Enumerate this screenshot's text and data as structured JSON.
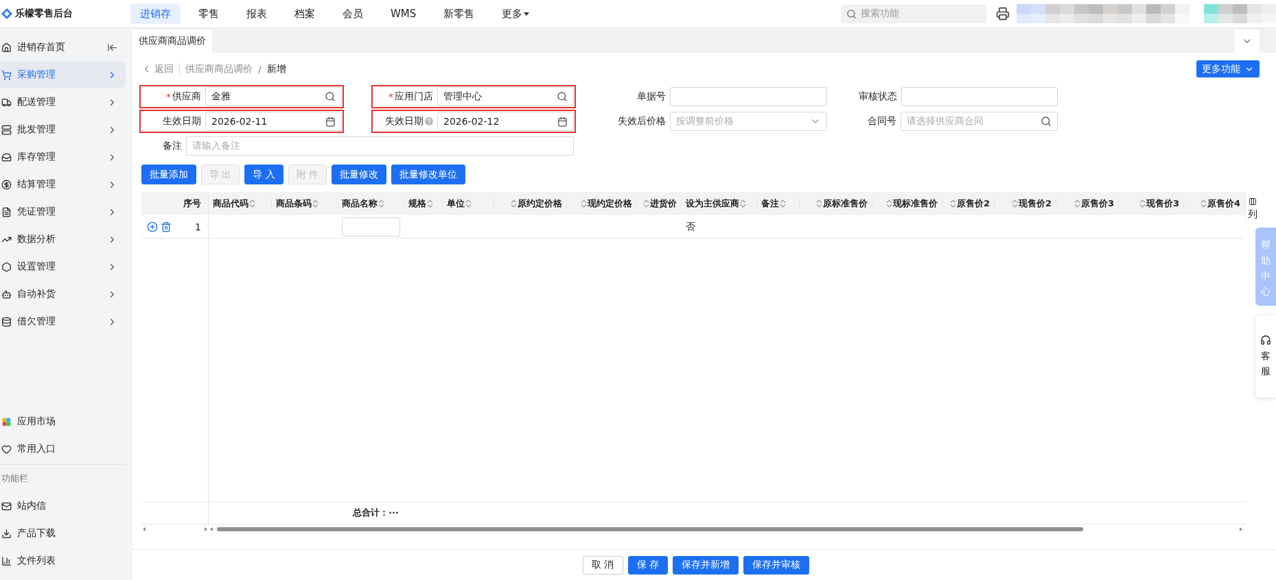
{
  "app": {
    "name": "乐檬零售后台"
  },
  "top_nav": [
    {
      "label": "进销存",
      "selected": true
    },
    {
      "label": "零售",
      "selected": false
    },
    {
      "label": "报表",
      "selected": false
    },
    {
      "label": "档案",
      "selected": false
    },
    {
      "label": "会员",
      "selected": false
    },
    {
      "label": "WMS",
      "selected": false
    },
    {
      "label": "新零售",
      "selected": false
    },
    {
      "label": "更多",
      "selected": false,
      "dropdown": true
    }
  ],
  "search": {
    "placeholder": "搜索功能"
  },
  "sidebar": {
    "items": [
      {
        "label": "进销存首页",
        "selected": false,
        "kind": "home"
      },
      {
        "label": "采购管理",
        "selected": true,
        "kind": "menu"
      },
      {
        "label": "配送管理",
        "selected": false,
        "kind": "menu"
      },
      {
        "label": "批发管理",
        "selected": false,
        "kind": "menu"
      },
      {
        "label": "库存管理",
        "selected": false,
        "kind": "menu"
      },
      {
        "label": "结算管理",
        "selected": false,
        "kind": "menu"
      },
      {
        "label": "凭证管理",
        "selected": false,
        "kind": "menu"
      },
      {
        "label": "数据分析",
        "selected": false,
        "kind": "menu"
      },
      {
        "label": "设置管理",
        "selected": false,
        "kind": "menu"
      },
      {
        "label": "自动补货",
        "selected": false,
        "kind": "menu"
      },
      {
        "label": "借欠管理",
        "selected": false,
        "kind": "menu"
      }
    ],
    "shortcuts": [
      {
        "label": "应用市场"
      },
      {
        "label": "常用入口"
      }
    ],
    "toolbar_heading": "功能栏",
    "tools": [
      {
        "label": "站内信"
      },
      {
        "label": "产品下载"
      },
      {
        "label": "文件列表"
      }
    ]
  },
  "tabs": [
    {
      "label": "供应商商品调价",
      "selected": true
    }
  ],
  "breadcrumb": {
    "back": "返回",
    "parent": "供应商商品调价",
    "separator": "/",
    "current": "新增"
  },
  "more_button": "更多功能",
  "form": {
    "rows": [
      [
        {
          "label": "供应商",
          "required_mark": "*",
          "kind": "search",
          "value": "金雅",
          "highlighted": true
        },
        {
          "label": "应用门店",
          "required_mark": "*",
          "kind": "search",
          "value": "管理中心",
          "highlighted": true
        },
        {
          "label": "单据号",
          "kind": "text",
          "highlighted": false
        },
        {
          "label": "审核状态",
          "kind": "text",
          "highlighted": false
        }
      ],
      [
        {
          "label": "生效日期",
          "kind": "date",
          "value": "2026-02-11",
          "highlighted": true
        },
        {
          "label": "失效日期",
          "kind": "date",
          "help": true,
          "value": "2026-02-12",
          "highlighted": true
        },
        {
          "label": "失效后价格",
          "kind": "select",
          "placeholder": "按调整前价格",
          "highlighted": false
        },
        {
          "label": "合同号",
          "kind": "search",
          "placeholder": "请选择供应商合同",
          "highlighted": false
        }
      ],
      [
        {
          "label": "备注",
          "kind": "wide",
          "placeholder": "请输入备注",
          "highlighted": false
        }
      ]
    ]
  },
  "actions": [
    {
      "label": "批量添加",
      "disabled": false
    },
    {
      "label": "导 出",
      "disabled": true
    },
    {
      "label": "导 入",
      "disabled": false
    },
    {
      "label": "附 件",
      "disabled": true
    },
    {
      "label": "批量修改",
      "disabled": false
    },
    {
      "label": "批量修改单位",
      "disabled": false
    }
  ],
  "table": {
    "index_header": "序号",
    "columns": [
      {
        "label": "商品代码",
        "kind": "trailing"
      },
      {
        "label": "商品条码",
        "kind": "trailing"
      },
      {
        "label": "商品名称",
        "kind": "trailing"
      },
      {
        "label": "规格",
        "kind": "trailing"
      },
      {
        "label": "单位",
        "kind": "trailing"
      },
      {
        "label": "原约定价格",
        "kind": "leading"
      },
      {
        "label": "现约定价格",
        "kind": "leading"
      },
      {
        "label": "进货价",
        "kind": "leading"
      },
      {
        "label": "设为主供应商",
        "kind": "trailing"
      },
      {
        "label": "备注",
        "kind": "trailing"
      },
      {
        "label": "原标准售价",
        "kind": "leading"
      },
      {
        "label": "现标准售价",
        "kind": "leading"
      },
      {
        "label": "原售价2",
        "kind": "leading"
      },
      {
        "label": "现售价2",
        "kind": "leading"
      },
      {
        "label": "原售价3",
        "kind": "leading"
      },
      {
        "label": "现售价3",
        "kind": "leading"
      },
      {
        "label": "原售价4",
        "kind": "leading"
      }
    ],
    "column_settings": "列",
    "rows": [
      {
        "index": "1",
        "cells": [
          {
            "kind": "empty"
          },
          {
            "kind": "empty"
          },
          {
            "kind": "input"
          },
          {
            "kind": "empty"
          },
          {
            "kind": "empty"
          },
          {
            "kind": "empty"
          },
          {
            "kind": "empty"
          },
          {
            "kind": "empty"
          },
          {
            "kind": "text",
            "text": "否"
          },
          {
            "kind": "empty"
          },
          {
            "kind": "empty"
          },
          {
            "kind": "empty"
          },
          {
            "kind": "empty"
          },
          {
            "kind": "empty"
          },
          {
            "kind": "empty"
          },
          {
            "kind": "empty"
          },
          {
            "kind": "empty"
          }
        ]
      }
    ],
    "total": "总合计：···"
  },
  "footer_buttons": [
    {
      "label": "取 消",
      "primary": false
    },
    {
      "label": "保 存",
      "primary": true
    },
    {
      "label": "保存并新增",
      "primary": true
    },
    {
      "label": "保存并审核",
      "primary": true
    }
  ],
  "side_tabs": [
    {
      "label": "帮助中心",
      "kind": "help"
    },
    {
      "label": "客服",
      "kind": "service"
    }
  ]
}
